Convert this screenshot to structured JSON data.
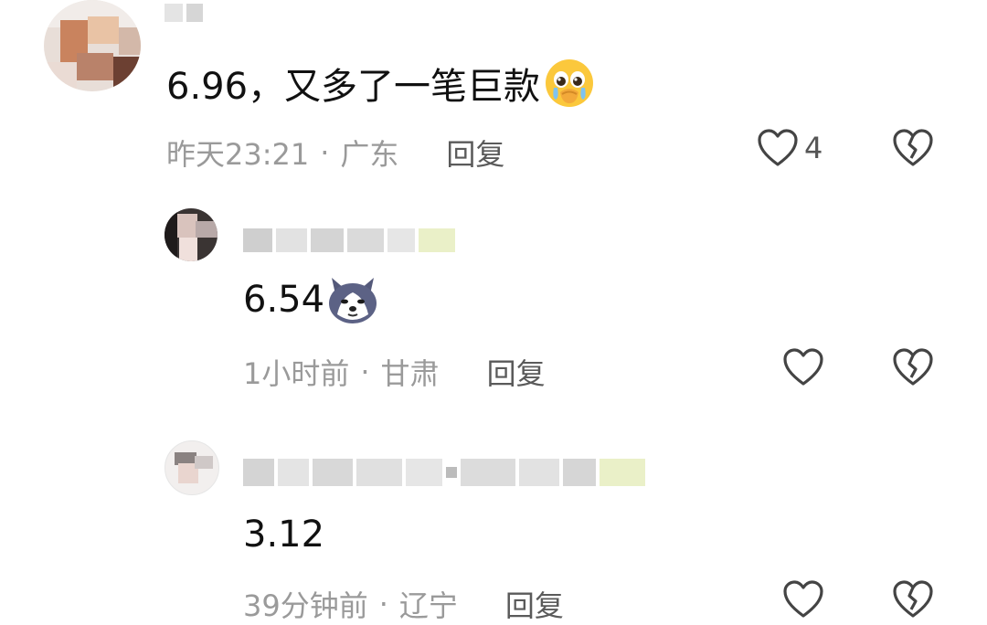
{
  "comments": [
    {
      "text": "6.96，又多了一笔巨款",
      "emoji": "crying-touched-emoji",
      "time": "昨天23:21",
      "separator": "·",
      "location": "广东",
      "reply_label": "回复",
      "like_count": "4"
    },
    {
      "text": "6.54",
      "emoji": "husky-dog-emoji",
      "time": "1小时前",
      "separator": "·",
      "location": "甘肃",
      "reply_label": "回复",
      "like_count": ""
    },
    {
      "text": "3.12",
      "time": "39分钟前",
      "separator": "·",
      "location": "辽宁",
      "reply_label": "回复",
      "like_count": ""
    }
  ],
  "colors": {
    "meta_gray": "#9a9a9a",
    "text_black": "#111111",
    "icon_gray": "#444444"
  }
}
